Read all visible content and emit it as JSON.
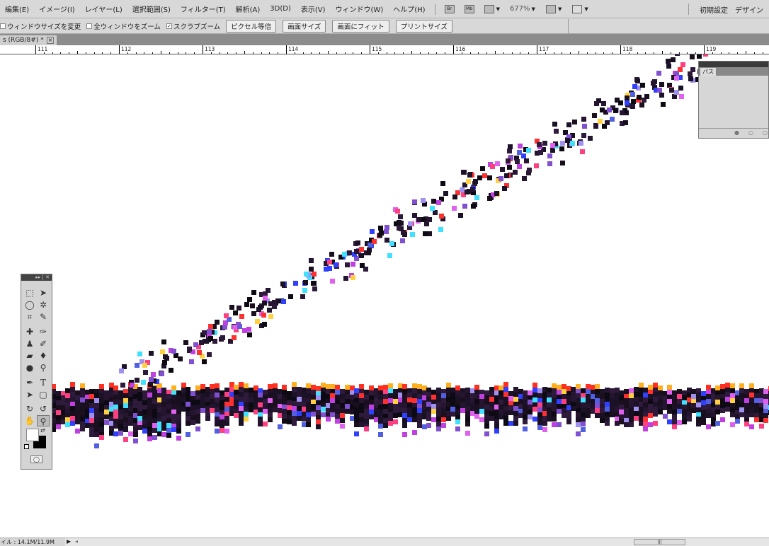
{
  "menu": [
    "編集(E)",
    "イメージ(I)",
    "レイヤー(L)",
    "選択範囲(S)",
    "フィルター(T)",
    "解析(A)",
    "3D(D)",
    "表示(V)",
    "ウィンドウ(W)",
    "ヘルプ(H)"
  ],
  "appbar": {
    "bridge": "Br",
    "minibridge": "Mb",
    "zoom": "677%",
    "workspace_default": "初期設定",
    "workspace_design": "デザイン"
  },
  "options": {
    "resize_windows": "ウィンドウサイズを変更",
    "zoom_all": "全ウィンドウをズーム",
    "scrubby_zoom": "スクラブズーム",
    "scrubby_checked": true,
    "actual_pixels": "ピクセル等倍",
    "fit_screen": "画面サイズ",
    "fill_screen": "画面にフィット",
    "print_size": "プリントサイズ"
  },
  "document": {
    "tab_title": "s (RGB/8#) *",
    "close": "×"
  },
  "ruler": [
    "111",
    "112",
    "113",
    "114",
    "115",
    "116",
    "117",
    "118",
    "119"
  ],
  "status": {
    "file_info": "イル : 14.1M/11.9M"
  },
  "paths_panel": {
    "tab": "パス"
  },
  "colors": {
    "foreground": "#000000",
    "background": "#ffffff"
  }
}
